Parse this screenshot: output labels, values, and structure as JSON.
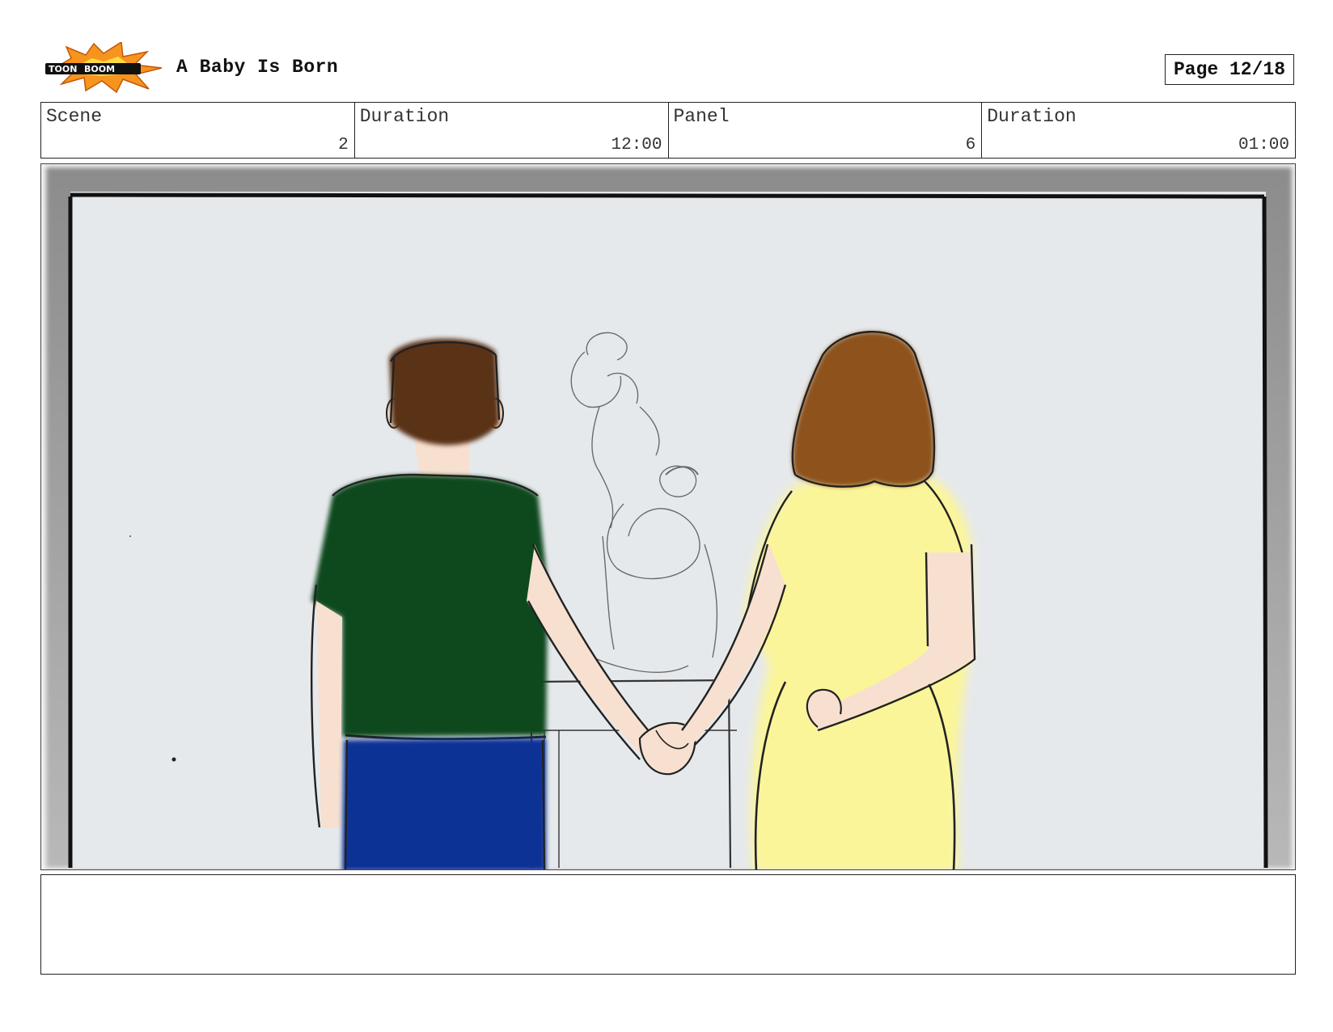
{
  "brand": {
    "logo_text_1": "TOON",
    "logo_text_2": "BOOM",
    "logo_icon": "burst-logo-icon"
  },
  "header": {
    "title": "A Baby Is Born",
    "page_label": "Page 12/18"
  },
  "info": {
    "scene_label": "Scene",
    "scene_value": "2",
    "scene_duration_label": "Duration",
    "scene_duration_value": "12:00",
    "panel_label": "Panel",
    "panel_value": "6",
    "panel_duration_label": "Duration",
    "panel_duration_value": "01:00"
  },
  "notes": {
    "text": ""
  },
  "colors": {
    "burst": "#f7941d",
    "hair_man": "#5a3212",
    "shirt": "#0c4a1c",
    "pants": "#0a3396",
    "hair_woman": "#8e531c",
    "dress": "#fbf59a",
    "skin": "#f7e0cf",
    "wall": "#e6e9ec"
  }
}
